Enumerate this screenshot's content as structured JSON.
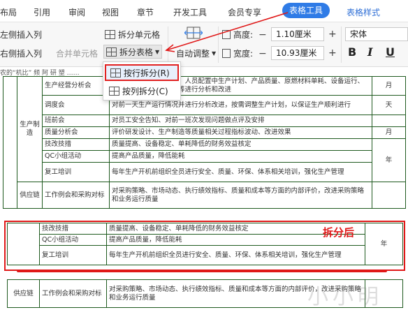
{
  "menu": {
    "items": [
      "布局",
      "引用",
      "审阅",
      "视图",
      "章节",
      "开发工具",
      "会员专享"
    ],
    "active_tab": "表格工具",
    "style_tab": "表格样式"
  },
  "ribbon": {
    "insert_left": "左侧插入列",
    "insert_right": "右侧插入列",
    "merge_cells": "合并单元格",
    "split_cells": "拆分单元格",
    "split_table": "拆分表格",
    "auto_fit": "自动调整",
    "height_label": "高度:",
    "height_value": "1.10厘米",
    "width_label": "宽度:",
    "width_value": "10.93厘米",
    "font_value": "宋体",
    "bold": "B",
    "italic": "I",
    "underline": "U"
  },
  "dropdown": {
    "by_row": "按行拆分(R)",
    "by_col": "按列拆分(C)"
  },
  "table_top": {
    "partial_header": "农的“机比” 频 阿 研 塑 ……",
    "rows": [
      {
        "name": "生产经营分析会",
        "desc": "生产经营中生产、计划、人员配置中生产计划、产品质量、原燃材料单耗、设备运行、成本、安全和现场管理等进行分析和改进",
        "freq": "月"
      },
      {
        "name": "调度会",
        "desc": "对前一天生产运行情况并进行分析改进，按需调整生产计划，以保证生产顺利进行",
        "freq": "天"
      },
      {
        "name": "班前会",
        "desc": "对员工安全告知、对前一班次发现问题做点评及安排",
        "freq": ""
      },
      {
        "name": "质量分析会",
        "desc": "评价研发设计、生产制造等质量相关过程指标波动、改进效果",
        "freq": "月"
      },
      {
        "name": "技改技措",
        "desc": "质量提高、设备稳定、单耗降低的财务效益核定",
        "freq": ""
      },
      {
        "name": "QC小组活动",
        "desc": "提高产品质量，降低能耗",
        "freq": ""
      },
      {
        "name": "复工培训",
        "desc": "每年生产开机前组织全员进行安全、质量、环保、体系相关培训，强化生产管理",
        "freq": ""
      }
    ],
    "group_production": "生产制造",
    "freq_year": "年",
    "supply_group": "供应链",
    "supply_name": "工作例会和采购对标",
    "supply_desc": "对采购策略、市场动态、执行绩效指标、质量和成本等方面的内部评价，改进采购策略和业务运行质量"
  },
  "table_split": {
    "rows": [
      {
        "name": "技改技措",
        "desc": "质量提高、设备稳定、单耗降低的财务效益核定"
      },
      {
        "name": "QC小组活动",
        "desc": "提高产品质量，降低能耗"
      },
      {
        "name": "复工培训",
        "desc": "每年生产开机前组织全员进行安全、质量、环保、体系相关培训，强化生产管理"
      }
    ],
    "freq": "年",
    "supply_group": "供应链",
    "supply_name": "工作例会和采购对标",
    "supply_desc": "对采购策略、市场动态、执行绩效指标、质量和成本等方面的内部评价，改进采购策略和业务运行质量"
  },
  "annotation": {
    "after_split": "拆分后",
    "watermark": "小小明"
  },
  "colors": {
    "accent": "#2f7be6",
    "highlight_red": "#e01818",
    "table_border": "#1f5a1f"
  }
}
